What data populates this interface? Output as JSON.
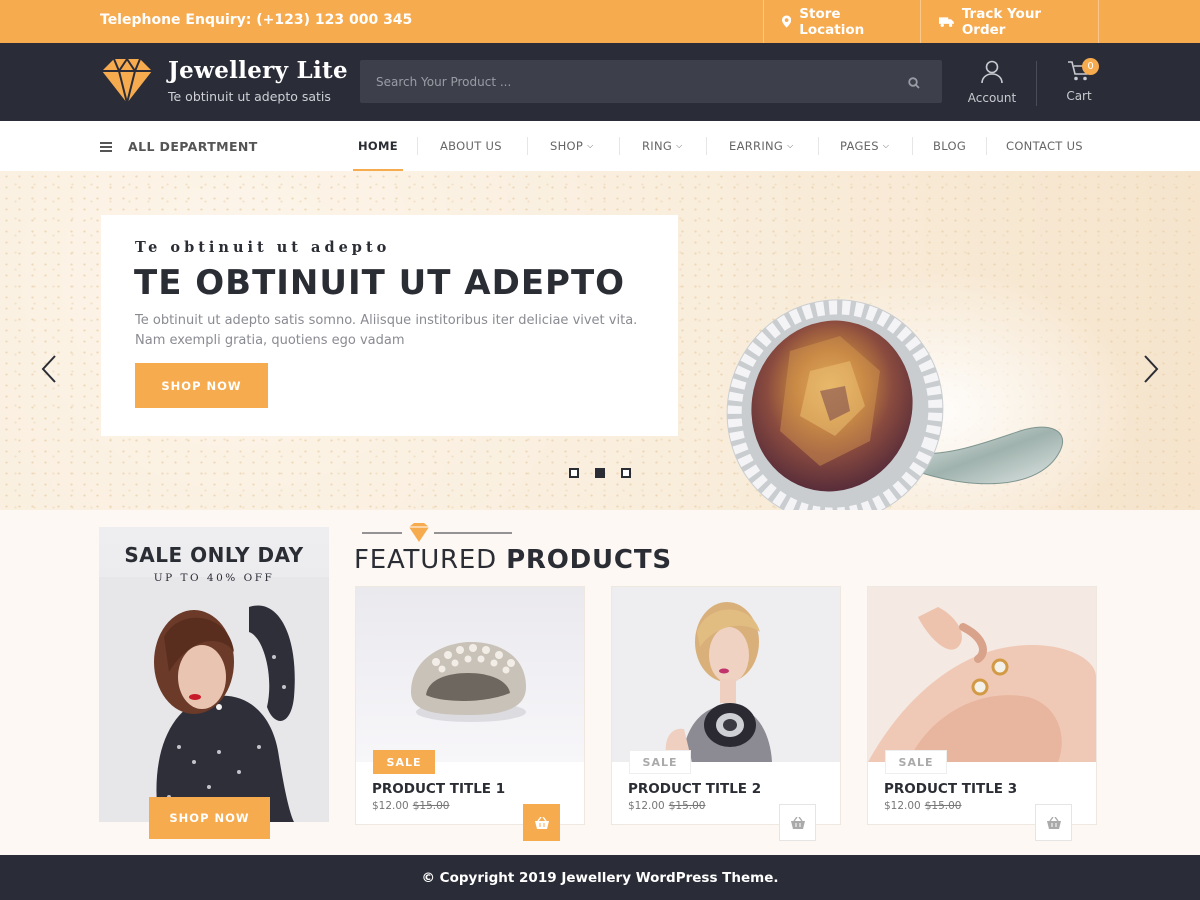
{
  "topbar": {
    "phone": "Telephone Enquiry: (+123) 123 000 345",
    "store_location": "Store Location",
    "track_order": "Track Your Order"
  },
  "header": {
    "site_title": "Jewellery Lite",
    "tagline": "Te obtinuit ut adepto satis",
    "search_placeholder": "Search Your Product ...",
    "account_label": "Account",
    "cart_label": "Cart",
    "cart_count": "0"
  },
  "nav": {
    "department": "ALL DEPARTMENT",
    "items": [
      {
        "label": "HOME",
        "caret": false,
        "active": true
      },
      {
        "label": "ABOUT US",
        "caret": false
      },
      {
        "label": "SHOP",
        "caret": true
      },
      {
        "label": "RING",
        "caret": true
      },
      {
        "label": "EARRING",
        "caret": true
      },
      {
        "label": "PAGES",
        "caret": true
      },
      {
        "label": "BLOG",
        "caret": false
      },
      {
        "label": "CONTACT US",
        "caret": false
      }
    ]
  },
  "hero": {
    "subtitle": "Te obtinuit ut adepto",
    "title": "TE OBTINUIT UT ADEPTO",
    "text": "Te obtinuit ut adepto satis somno. Aliisque institoribus iter deliciae vivet vita. Nam exempli gratia, quotiens ego vadam",
    "button": "SHOP NOW",
    "slides": 3,
    "active_slide": 2
  },
  "promo": {
    "title": "SALE ONLY DAY",
    "subtitle": "UP TO 40% OFF",
    "button": "SHOP NOW"
  },
  "featured": {
    "title_light": "FEATURED",
    "title_bold": "PRODUCTS",
    "products": [
      {
        "badge": "SALE",
        "title": "PRODUCT TITLE 1",
        "price": "$12.00",
        "old_price": "$15.00"
      },
      {
        "badge": "SALE",
        "title": "PRODUCT TITLE 2",
        "price": "$12.00",
        "old_price": "$15.00"
      },
      {
        "badge": "SALE",
        "title": "PRODUCT TITLE 3",
        "price": "$12.00",
        "old_price": "$15.00"
      }
    ]
  },
  "footer": {
    "copyright": "© Copyright 2019 Jewellery WordPress Theme."
  },
  "colors": {
    "accent": "#f7ab4f",
    "dark": "#2a2d38"
  },
  "icons": [
    "map-pin-icon",
    "truck-icon",
    "diamond-logo-icon",
    "search-icon",
    "user-icon",
    "cart-icon",
    "hamburger-icon",
    "chevron-left-icon",
    "chevron-right-icon",
    "basket-icon"
  ]
}
